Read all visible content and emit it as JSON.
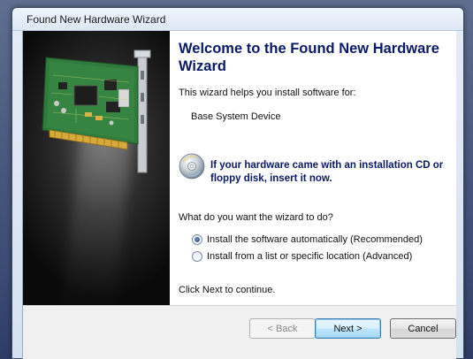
{
  "window": {
    "title": "Found New Hardware Wizard"
  },
  "wizard": {
    "heading": "Welcome to the Found New Hardware Wizard",
    "intro": "This wizard helps you install software for:",
    "device_name": "Base System Device",
    "cd_prompt": "If your hardware came with an installation CD or floppy disk, insert it now.",
    "question": "What do you want the wizard to do?",
    "options": [
      {
        "label": "Install the software automatically (Recommended)",
        "selected": true
      },
      {
        "label": "Install from a list or specific location (Advanced)",
        "selected": false
      }
    ],
    "continue_text": "Click Next to continue."
  },
  "buttons": {
    "back": "< Back",
    "next": "Next >",
    "cancel": "Cancel"
  },
  "icons": {
    "hardware_image": "pci-card-image",
    "cd": "cd-disc-icon"
  },
  "colors": {
    "heading": "#0b1a66",
    "side_panel": "#1a1a1a"
  }
}
